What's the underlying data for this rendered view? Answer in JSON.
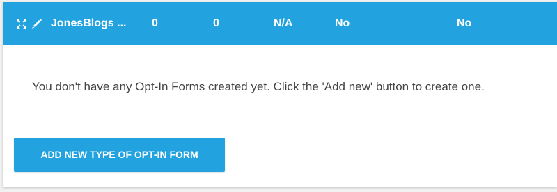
{
  "row": {
    "icons": [
      "expand-icon",
      "pencil-icon"
    ],
    "name": "JonesBlogs ...",
    "col1": "0",
    "col2": "0",
    "col3": "N/A",
    "col4": "No",
    "col5": "No"
  },
  "empty_message": "You don't have any Opt-In Forms created yet. Click the 'Add new' button to create one.",
  "add_button_label": "ADD NEW TYPE OF OPT-IN FORM",
  "colors": {
    "accent": "#22a3e0",
    "text": "#444444",
    "panel_bg": "#ffffff",
    "page_bg": "#f1f1f1"
  }
}
